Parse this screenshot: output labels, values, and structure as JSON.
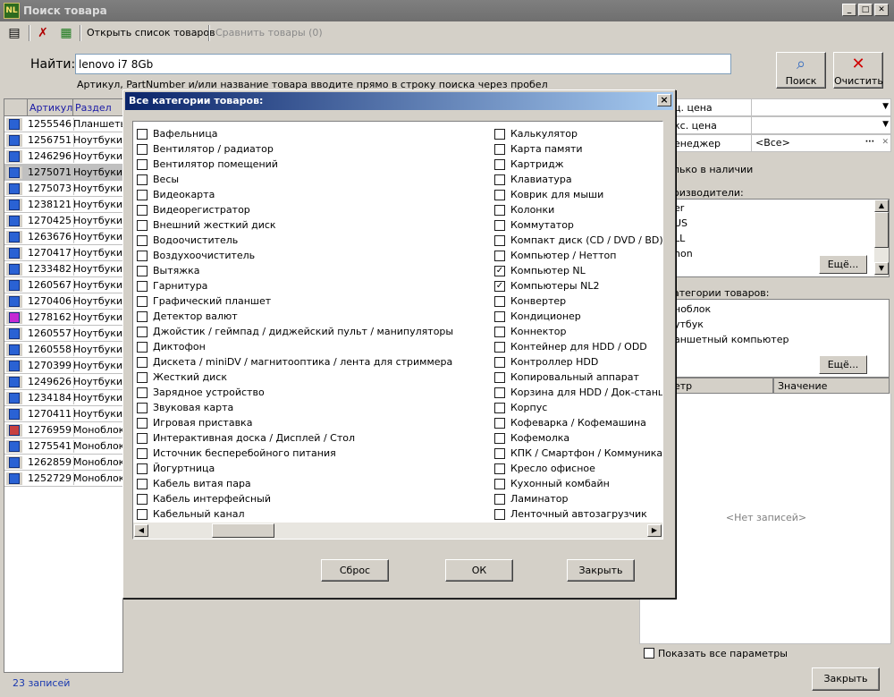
{
  "window": {
    "title": "Поиск товара",
    "app_icon": "NL"
  },
  "toolbar": {
    "open_list": "Открыть список товаров",
    "compare": "Сравнить товары (0)"
  },
  "search": {
    "label": "Найти:",
    "value": "lenovo i7 8Gb",
    "hint": "Артикул, PartNumber и/или название товара вводите прямо в строку поиска через пробел",
    "search_button": "Поиск",
    "clear_button": "Очистить"
  },
  "table": {
    "headers": [
      "Артикул",
      "Раздел"
    ],
    "rows": [
      {
        "article": "1255546",
        "section": "Планшеты",
        "icon": "blue"
      },
      {
        "article": "1256751",
        "section": "Ноутбуки",
        "icon": "blue"
      },
      {
        "article": "1246296",
        "section": "Ноутбуки",
        "icon": "blue"
      },
      {
        "article": "1275071",
        "section": "Ноутбуки",
        "icon": "blue"
      },
      {
        "article": "1275073",
        "section": "Ноутбуки",
        "icon": "blue"
      },
      {
        "article": "1238121",
        "section": "Ноутбуки",
        "icon": "blue"
      },
      {
        "article": "1270425",
        "section": "Ноутбуки",
        "icon": "blue"
      },
      {
        "article": "1263676",
        "section": "Ноутбуки",
        "icon": "blue"
      },
      {
        "article": "1270417",
        "section": "Ноутбуки",
        "icon": "blue"
      },
      {
        "article": "1233482",
        "section": "Ноутбуки",
        "icon": "blue"
      },
      {
        "article": "1260567",
        "section": "Ноутбуки",
        "icon": "blue"
      },
      {
        "article": "1270406",
        "section": "Ноутбуки",
        "icon": "blue"
      },
      {
        "article": "1278162",
        "section": "Ноутбуки",
        "icon": "pink"
      },
      {
        "article": "1260557",
        "section": "Ноутбуки",
        "icon": "blue"
      },
      {
        "article": "1260558",
        "section": "Ноутбуки",
        "icon": "blue"
      },
      {
        "article": "1270399",
        "section": "Ноутбуки",
        "icon": "blue"
      },
      {
        "article": "1249626",
        "section": "Ноутбуки",
        "icon": "blue"
      },
      {
        "article": "1234184",
        "section": "Ноутбуки",
        "icon": "blue"
      },
      {
        "article": "1270411",
        "section": "Ноутбуки",
        "icon": "blue"
      },
      {
        "article": "1276959",
        "section": "Моноблоки",
        "icon": "mono"
      },
      {
        "article": "1275541",
        "section": "Моноблоки",
        "icon": "blue"
      },
      {
        "article": "1262859",
        "section": "Моноблоки",
        "icon": "blue"
      },
      {
        "article": "1252729",
        "section": "Моноблоки",
        "icon": "blue"
      }
    ],
    "selected_index": 3,
    "records_count": "23 записей"
  },
  "right_panel": {
    "filter_rows": [
      {
        "label": "ц. цена",
        "value": ""
      },
      {
        "label": "кс. цена",
        "value": ""
      },
      {
        "label": "енеджер",
        "value": "<Все>"
      }
    ],
    "only_in_stock": "лько в наличии",
    "manufacturers_label": "оизводители:",
    "manufacturers": [
      "er",
      "US",
      "LL",
      "non"
    ],
    "more_button": "Ещё...",
    "categories_label": "атегории товаров:",
    "categories": [
      "ноблок",
      "утбук",
      "аншетный компьютер"
    ],
    "grid_headers": [
      "етр",
      "Значение"
    ],
    "no_records": "<Нет записей>",
    "show_all_params": "Показать все параметры",
    "close_button": "Закрыть"
  },
  "dialog": {
    "title": "Все категории товаров:",
    "close_glyph": "×",
    "left_column": [
      {
        "label": "Вафельница",
        "checked": false
      },
      {
        "label": "Вентилятор / радиатор",
        "checked": false
      },
      {
        "label": "Вентилятор помещений",
        "checked": false
      },
      {
        "label": "Весы",
        "checked": false
      },
      {
        "label": "Видеокарта",
        "checked": false
      },
      {
        "label": "Видеорегистратор",
        "checked": false
      },
      {
        "label": "Внешний жесткий диск",
        "checked": false
      },
      {
        "label": "Водоочиститель",
        "checked": false
      },
      {
        "label": "Воздухоочиститель",
        "checked": false
      },
      {
        "label": "Вытяжка",
        "checked": false
      },
      {
        "label": "Гарнитура",
        "checked": false
      },
      {
        "label": "Графический планшет",
        "checked": false
      },
      {
        "label": "Детектор валют",
        "checked": false
      },
      {
        "label": "Джойстик / геймпад / диджейский пульт / манипуляторы",
        "checked": false
      },
      {
        "label": "Диктофон",
        "checked": false
      },
      {
        "label": "Дискета / miniDV / магнитооптика / лента для стриммера",
        "checked": false
      },
      {
        "label": "Жесткий диск",
        "checked": false
      },
      {
        "label": "Зарядное устройство",
        "checked": false
      },
      {
        "label": "Звуковая карта",
        "checked": false
      },
      {
        "label": "Игровая приставка",
        "checked": false
      },
      {
        "label": "Интерактивная доска / Дисплей / Стол",
        "checked": false
      },
      {
        "label": "Источник бесперебойного питания",
        "checked": false
      },
      {
        "label": "Йогуртница",
        "checked": false
      },
      {
        "label": "Кабель витая пара",
        "checked": false
      },
      {
        "label": "Кабель интерфейсный",
        "checked": false
      },
      {
        "label": "Кабельный канал",
        "checked": false
      }
    ],
    "right_column": [
      {
        "label": "Калькулятор",
        "checked": false
      },
      {
        "label": "Карта памяти",
        "checked": false
      },
      {
        "label": "Картридж",
        "checked": false
      },
      {
        "label": "Клавиатура",
        "checked": false
      },
      {
        "label": "Коврик для мыши",
        "checked": false
      },
      {
        "label": "Колонки",
        "checked": false
      },
      {
        "label": "Коммутатор",
        "checked": false
      },
      {
        "label": "Компакт диск (CD / DVD / BD)",
        "checked": false
      },
      {
        "label": "Компьютер / Неттоп",
        "checked": false
      },
      {
        "label": "Компьютер NL",
        "checked": true
      },
      {
        "label": "Компьютеры NL2",
        "checked": true
      },
      {
        "label": "Конвертер",
        "checked": false
      },
      {
        "label": "Кондиционер",
        "checked": false
      },
      {
        "label": "Коннектор",
        "checked": false
      },
      {
        "label": "Контейнер для HDD / ODD",
        "checked": false
      },
      {
        "label": "Контроллер HDD",
        "checked": false
      },
      {
        "label": "Копировальный аппарат",
        "checked": false
      },
      {
        "label": "Корзина для HDD / Док-станция",
        "checked": false
      },
      {
        "label": "Корпус",
        "checked": false
      },
      {
        "label": "Кофеварка / Кофемашина",
        "checked": false
      },
      {
        "label": "Кофемолка",
        "checked": false
      },
      {
        "label": "КПК / Смартфон / Коммуникатор",
        "checked": false
      },
      {
        "label": "Кресло офисное",
        "checked": false
      },
      {
        "label": "Кухонный комбайн",
        "checked": false
      },
      {
        "label": "Ламинатор",
        "checked": false
      },
      {
        "label": "Ленточный автозагрузчик",
        "checked": false
      }
    ],
    "check_glyph": "✓",
    "buttons": {
      "reset": "Сброс",
      "ok": "ОК",
      "close": "Закрыть"
    }
  }
}
